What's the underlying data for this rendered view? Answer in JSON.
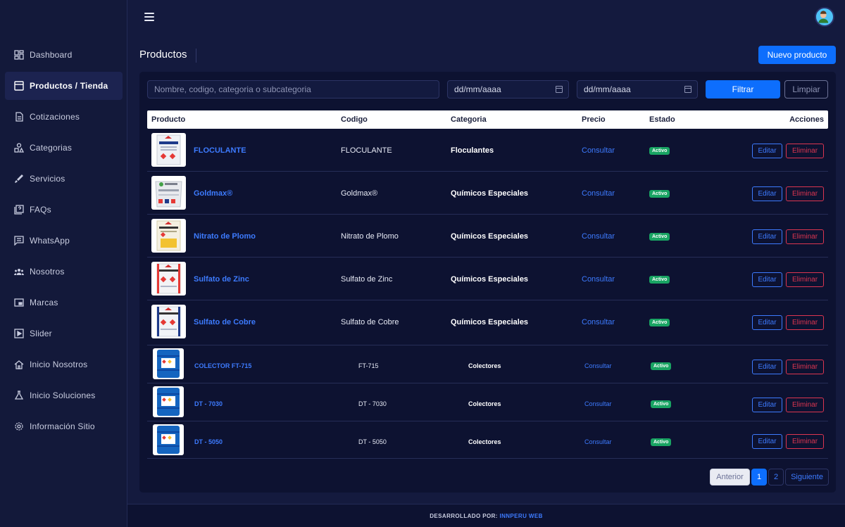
{
  "sidebar": {
    "items": [
      {
        "label": "Dashboard",
        "icon": "dashboard-icon"
      },
      {
        "label": "Productos / Tienda",
        "icon": "store-icon"
      },
      {
        "label": "Cotizaciones",
        "icon": "document-icon"
      },
      {
        "label": "Categorias",
        "icon": "shapes-icon"
      },
      {
        "label": "Servicios",
        "icon": "tools-icon"
      },
      {
        "label": "FAQs",
        "icon": "help-book-icon"
      },
      {
        "label": "WhatsApp",
        "icon": "chat-icon"
      },
      {
        "label": "Nosotros",
        "icon": "people-icon"
      },
      {
        "label": "Marcas",
        "icon": "image-icon"
      },
      {
        "label": "Slider",
        "icon": "play-icon"
      },
      {
        "label": "Inicio Nosotros",
        "icon": "home-icon"
      },
      {
        "label": "Inicio Soluciones",
        "icon": "flask-icon"
      },
      {
        "label": "Información Sitio",
        "icon": "gear-icon"
      }
    ]
  },
  "header": {
    "title": "Productos",
    "new_button": "Nuevo producto"
  },
  "filters": {
    "search_placeholder": "Nombre, codigo, categoria o subcategoria",
    "date_from": "dd/mm/aaaa",
    "date_to": "dd/mm/aaaa",
    "filter_label": "Filtrar",
    "clear_label": "Limpiar"
  },
  "table": {
    "columns": {
      "product": "Producto",
      "code": "Codigo",
      "category": "Categoria",
      "price": "Precio",
      "status": "Estado",
      "actions": "Acciones"
    },
    "edit_label": "Editar",
    "delete_label": "Eliminar",
    "rows": [
      {
        "name": "FLOCULANTE",
        "code": "FLOCULANTE",
        "category": "Floculantes",
        "price": "Consultar",
        "status": "Activo"
      },
      {
        "name": "Goldmax®",
        "code": "Goldmax®",
        "category": "Químicos Especiales",
        "price": "Consultar",
        "status": "Activo"
      },
      {
        "name": "Nitrato de Plomo",
        "code": "Nitrato de Plomo",
        "category": "Químicos Especiales",
        "price": "Consultar",
        "status": "Activo"
      },
      {
        "name": "Sulfato de Zinc",
        "code": "Sulfato de Zinc",
        "category": "Químicos Especiales",
        "price": "Consultar",
        "status": "Activo"
      },
      {
        "name": "Sulfato de Cobre",
        "code": "Sulfato de Cobre",
        "category": "Químicos Especiales",
        "price": "Consultar",
        "status": "Activo"
      },
      {
        "name": "COLECTOR FT-715",
        "code": "FT-715",
        "category": "Colectores",
        "price": "Consultar",
        "status": "Activo"
      },
      {
        "name": "DT - 7030",
        "code": "DT - 7030",
        "category": "Colectores",
        "price": "Consultar",
        "status": "Activo"
      },
      {
        "name": "DT - 5050",
        "code": "DT - 5050",
        "category": "Colectores",
        "price": "Consultar",
        "status": "Activo"
      }
    ]
  },
  "pagination": {
    "prev": "Anterior",
    "pages": [
      "1",
      "2"
    ],
    "next": "Siguiente"
  },
  "footer": {
    "text": "DESARROLLADO POR:",
    "link": "INNPERU WEB"
  },
  "colors": {
    "accent": "#0d6efd",
    "link": "#3d7bff",
    "success": "#19a463",
    "danger": "#dc3550",
    "background": "#141a3e"
  }
}
